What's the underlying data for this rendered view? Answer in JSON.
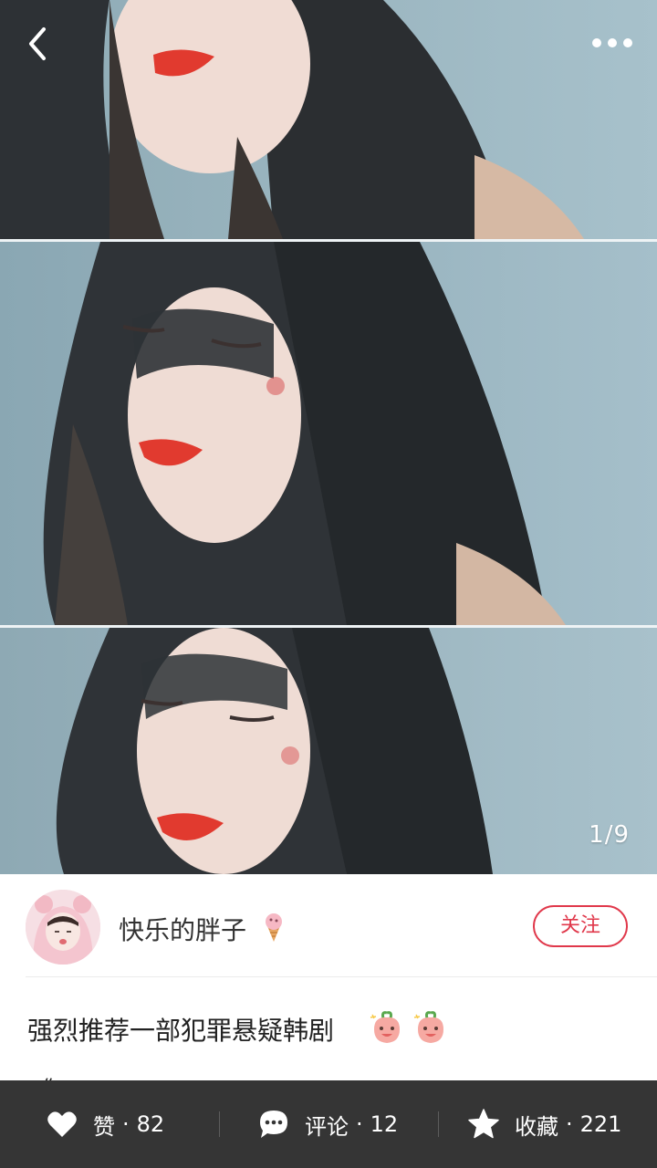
{
  "nav": {
    "back_icon": "chevron-left-icon",
    "more_icon": "more-dots-icon"
  },
  "gallery": {
    "page_indicator": "1/9",
    "image_description": "three-panel photo collage of a woman with long dark hair and red lips against a blue wall"
  },
  "author": {
    "name": "快乐的胖子",
    "name_emoji": "ice-cream-icon",
    "follow_label": "关注"
  },
  "post": {
    "title": "强烈推荐一部犯罪悬疑韩剧",
    "title_emojis": [
      "peach-face-icon",
      "peach-face-icon"
    ],
    "peek_text": "《"
  },
  "actions": {
    "like": {
      "label": "赞",
      "count": "82",
      "icon": "heart-icon"
    },
    "comment": {
      "label": "评论",
      "count": "12",
      "icon": "chat-bubble-icon"
    },
    "favorite": {
      "label": "收藏",
      "count": "221",
      "icon": "star-icon"
    },
    "separator": "·"
  },
  "colors": {
    "accent": "#e0384b",
    "bottom_bar": "#353535",
    "photo_bg": "#9fb6c2"
  }
}
